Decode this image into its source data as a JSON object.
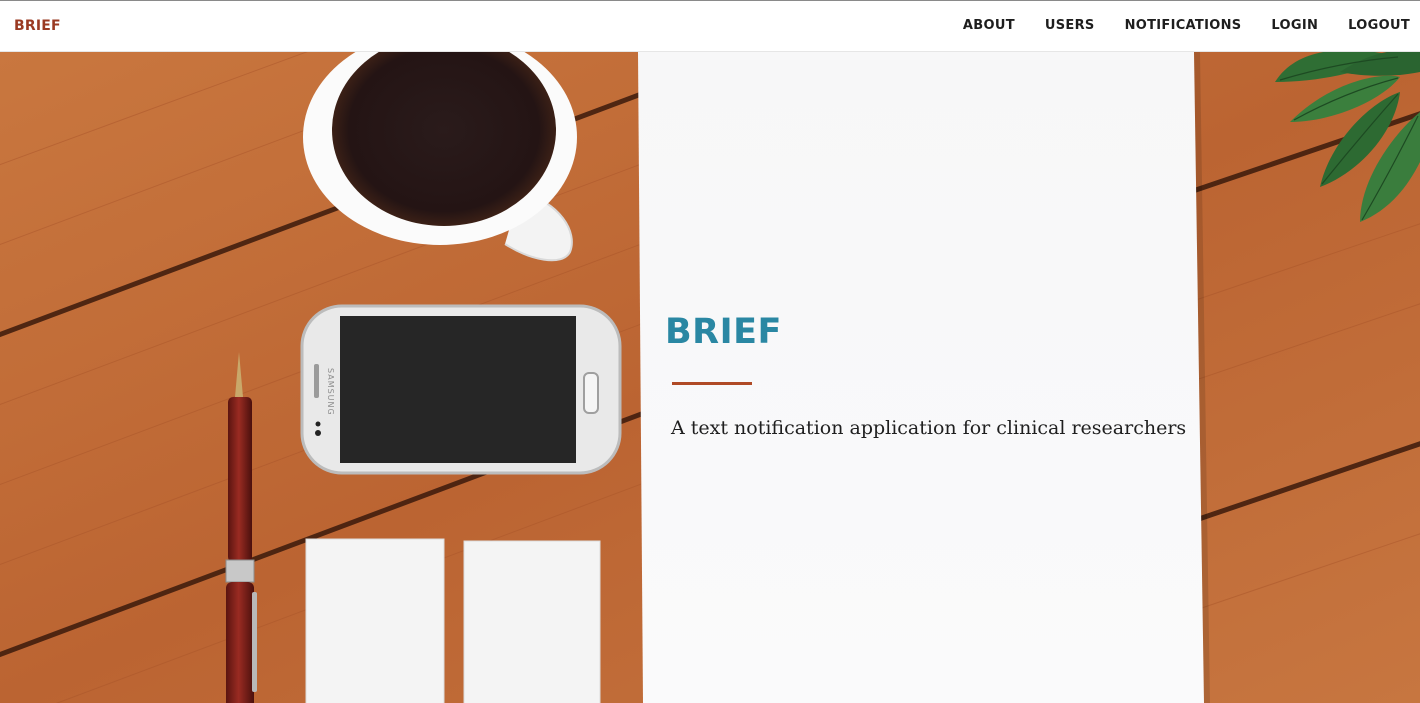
{
  "navbar": {
    "brand": "BRIEF",
    "links": [
      {
        "label": "ABOUT"
      },
      {
        "label": "USERS"
      },
      {
        "label": "NOTIFICATIONS"
      },
      {
        "label": "LOGIN"
      },
      {
        "label": "LOGOUT"
      }
    ]
  },
  "hero": {
    "title": "BRIEF",
    "subtitle": "A text notification application for clinical researchers",
    "phone_brand_text": "SAMSUNG"
  },
  "colors": {
    "brand": "#9a3a22",
    "title": "#2a87a3",
    "divider": "#b04a26",
    "wood": "#bf6a37"
  },
  "icons": {
    "phone": "smartphone-image",
    "coffee": "coffee-cup-image",
    "pen": "pen-image",
    "plant": "leaves-image"
  }
}
